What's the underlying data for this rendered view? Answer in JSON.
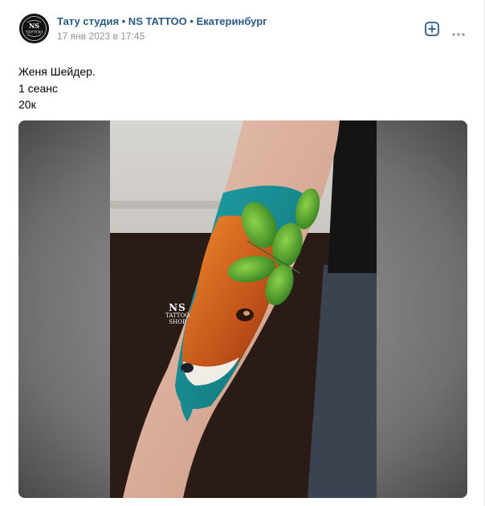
{
  "post": {
    "author": "Тату студия • NS TATTOO • Екатеринбург",
    "date": "17 янв 2023 в 17:45",
    "text_lines": [
      "Женя Шейдер.",
      "1 сеанс",
      "20к"
    ]
  },
  "avatar": {
    "logo_text_top": "NS",
    "logo_text_bottom": "TATTOO"
  },
  "photo": {
    "watermark_top": "NS",
    "watermark_middle": "TATTOO",
    "watermark_bottom": "SHOP"
  },
  "icons": {
    "add": "plus-square-icon",
    "more": "more-horizontal-icon"
  },
  "colors": {
    "link": "#2a5885",
    "meta": "#939393",
    "accent": "#2a5885"
  }
}
